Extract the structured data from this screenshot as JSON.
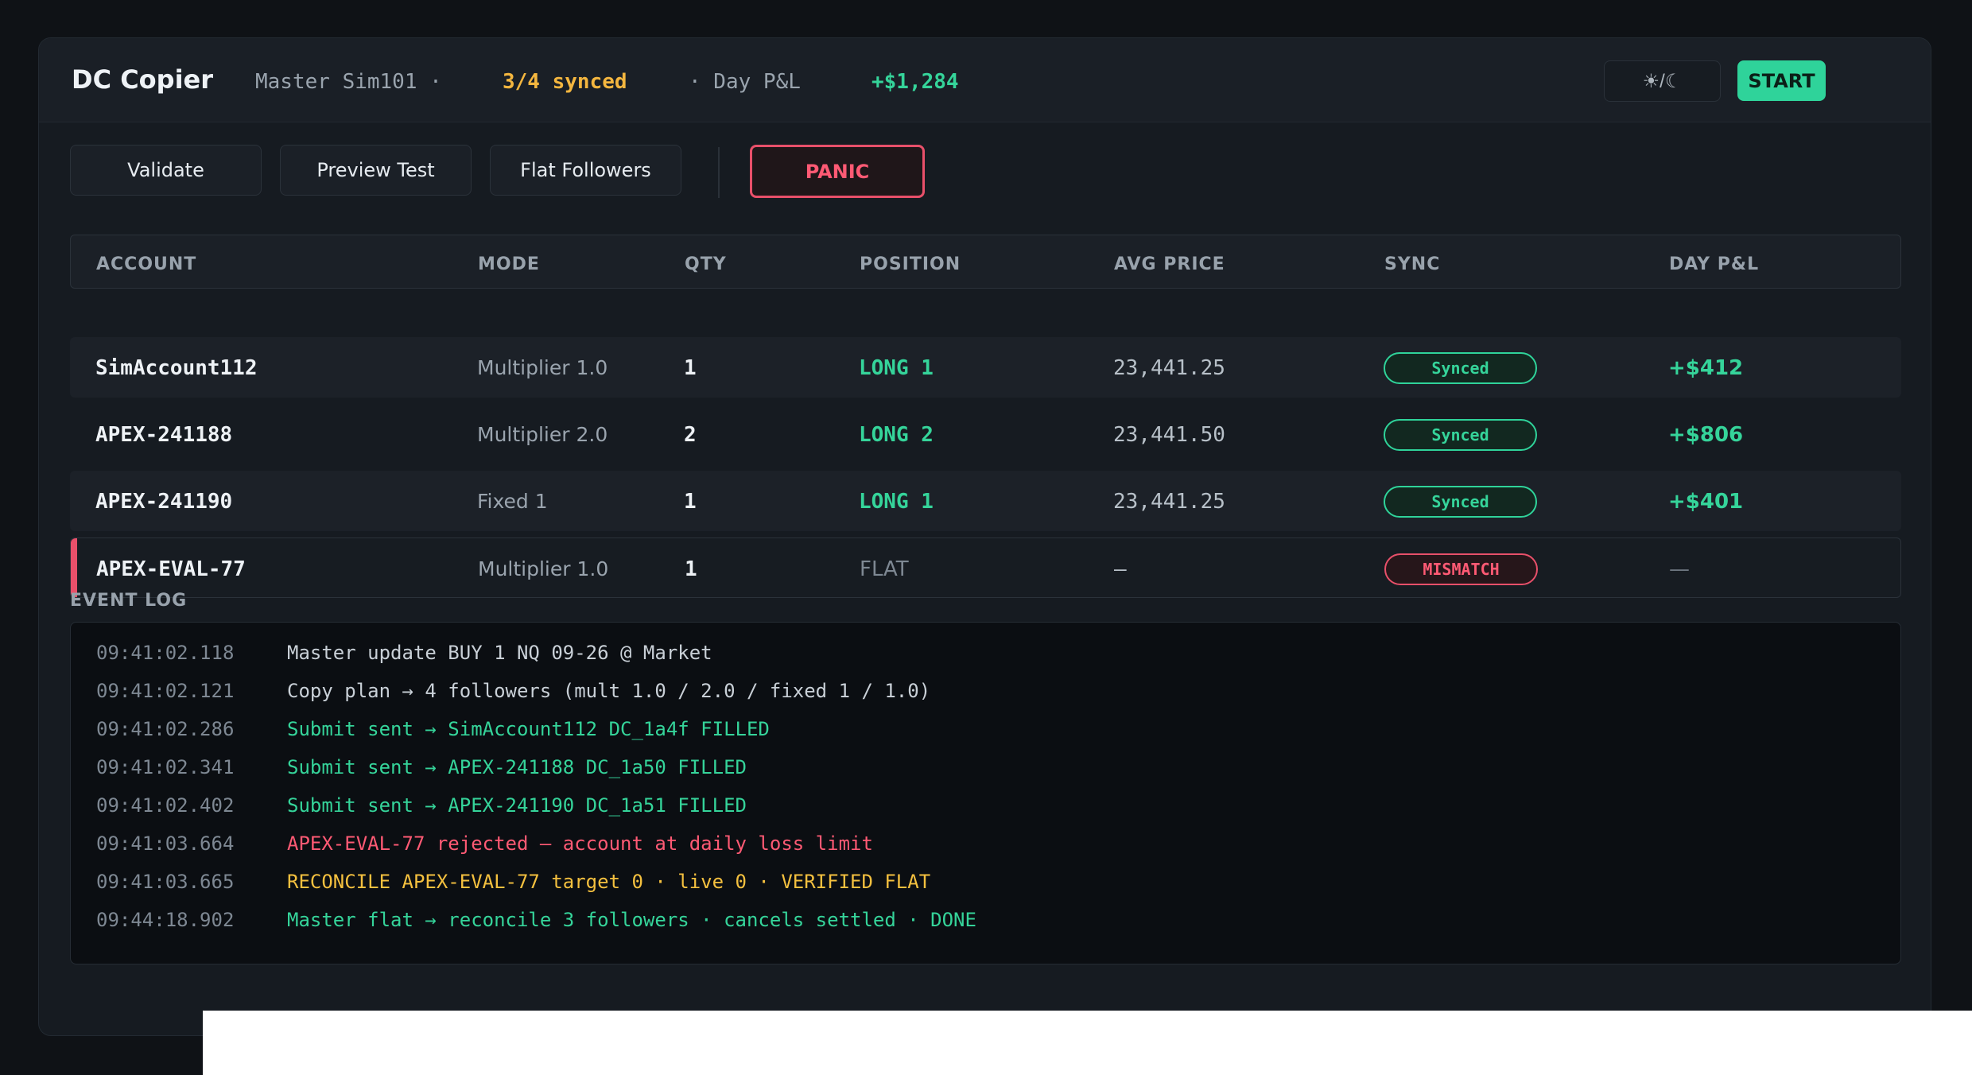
{
  "header": {
    "title": "DC Copier",
    "master": "Master Sim101 ·",
    "synced": "3/4 synced",
    "day_label": "· Day P&L",
    "day_pnl": "+$1,284",
    "theme_toggle": "☀/☾",
    "start_label": "START"
  },
  "toolbar": {
    "validate": "Validate",
    "preview": "Preview Test",
    "flat": "Flat Followers",
    "panic": "PANIC"
  },
  "table": {
    "headers": [
      "ACCOUNT",
      "MODE",
      "QTY",
      "POSITION",
      "AVG PRICE",
      "SYNC",
      "DAY P&L"
    ],
    "rows": [
      {
        "account": "SimAccount112",
        "mode": "Multiplier 1.0",
        "qty": "1",
        "position": "LONG 1",
        "avg": "23,441.25",
        "sync": "Synced",
        "pnl": "+$412"
      },
      {
        "account": "APEX-241188",
        "mode": "Multiplier 2.0",
        "qty": "2",
        "position": "LONG 2",
        "avg": "23,441.50",
        "sync": "Synced",
        "pnl": "+$806"
      },
      {
        "account": "APEX-241190",
        "mode": "Fixed 1",
        "qty": "1",
        "position": "LONG 1",
        "avg": "23,441.25",
        "sync": "Synced",
        "pnl": "+$401"
      },
      {
        "account": "APEX-EVAL-77",
        "mode": "Multiplier 1.0",
        "qty": "1",
        "position": "FLAT",
        "avg": "—",
        "sync": "MISMATCH",
        "pnl": "—"
      }
    ]
  },
  "event_log": {
    "label": "EVENT LOG",
    "entries": [
      {
        "time": "09:41:02.118",
        "msg": "Master update BUY 1 NQ 09-26 @ Market",
        "level": "info"
      },
      {
        "time": "09:41:02.121",
        "msg": "Copy plan → 4 followers (mult 1.0 / 2.0 / fixed 1 / 1.0)",
        "level": "info"
      },
      {
        "time": "09:41:02.286",
        "msg": "Submit sent → SimAccount112 DC_1a4f FILLED",
        "level": "ok"
      },
      {
        "time": "09:41:02.341",
        "msg": "Submit sent → APEX-241188 DC_1a50 FILLED",
        "level": "ok"
      },
      {
        "time": "09:41:02.402",
        "msg": "Submit sent → APEX-241190 DC_1a51 FILLED",
        "level": "ok"
      },
      {
        "time": "09:41:03.664",
        "msg": "APEX-EVAL-77 rejected — account at daily loss limit",
        "level": "err"
      },
      {
        "time": "09:41:03.665",
        "msg": "RECONCILE APEX-EVAL-77 target 0 · live 0 · VERIFIED FLAT",
        "level": "warn"
      },
      {
        "time": "09:44:18.902",
        "msg": "Master flat → reconcile 3 followers · cancels settled · DONE",
        "level": "ok"
      }
    ]
  },
  "colors": {
    "accent_green": "#2fd39a",
    "warn_yellow": "#f4b63f",
    "danger_red": "#e8506a",
    "background": "#0f1216"
  }
}
